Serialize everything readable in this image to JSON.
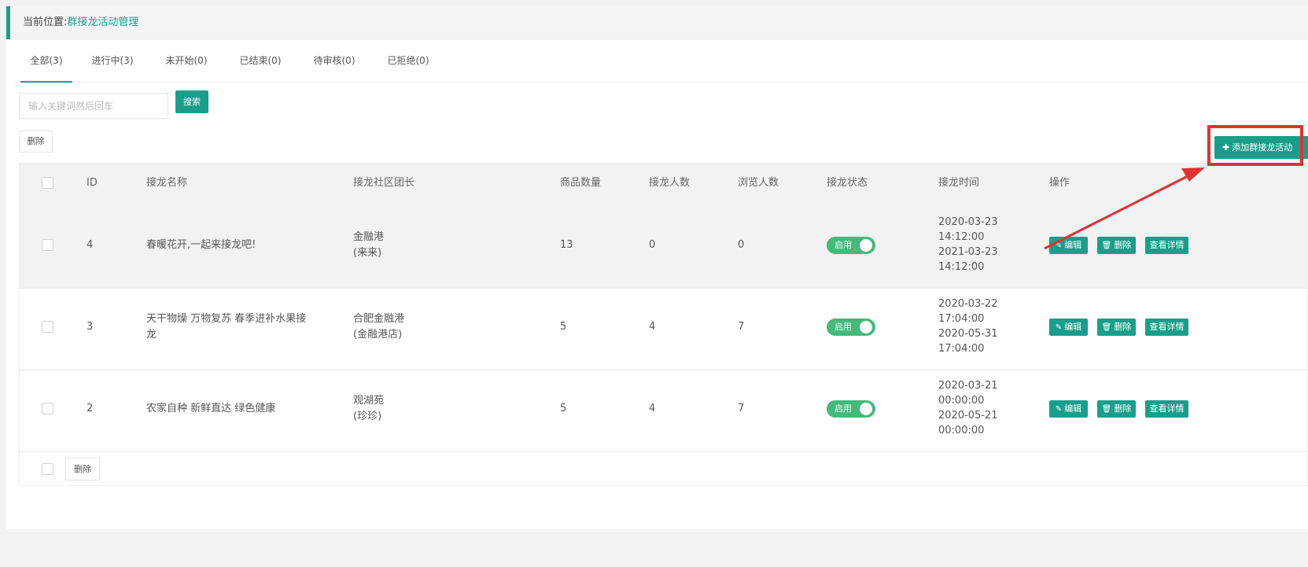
{
  "breadcrumb": {
    "prefix": "当前位置:",
    "current": "群接龙活动管理"
  },
  "tabs": [
    {
      "label": "全部(3)"
    },
    {
      "label": "进行中(3)"
    },
    {
      "label": "未开始(0)"
    },
    {
      "label": "已结束(0)"
    },
    {
      "label": "待审核(0)"
    },
    {
      "label": "已拒绝(0)"
    }
  ],
  "search": {
    "placeholder": "输入关键词然后回车",
    "button": "搜索"
  },
  "toolbar": {
    "delete": "删除",
    "add": "添加群接龙活动"
  },
  "table": {
    "headers": [
      "ID",
      "接龙名称",
      "接龙社区团长",
      "商品数量",
      "接龙人数",
      "浏览人数",
      "接龙状态",
      "接龙时间",
      "操作"
    ],
    "rows": [
      {
        "id": "4",
        "name": "春暖花开,一起来接龙吧!",
        "leader": "金融港",
        "leader_sub": "(来来)",
        "goods": "13",
        "join": "0",
        "views": "0",
        "status": "启用",
        "time_lines": [
          "2020-03-23",
          "14:12:00",
          "2021-03-23",
          "14:12:00"
        ]
      },
      {
        "id": "3",
        "name": "天干物燥 万物复苏 春季进补水果接龙",
        "leader": "合肥金融港",
        "leader_sub": "(金融港店)",
        "goods": "5",
        "join": "4",
        "views": "7",
        "status": "启用",
        "time_lines": [
          "2020-03-22",
          "17:04:00",
          "2020-05-31",
          "17:04:00"
        ]
      },
      {
        "id": "2",
        "name": "农家自种 新鲜直达 绿色健康",
        "leader": "观湖苑",
        "leader_sub": "(珍珍)",
        "goods": "5",
        "join": "4",
        "views": "7",
        "status": "启用",
        "time_lines": [
          "2020-03-21",
          "00:00:00",
          "2020-05-21",
          "00:00:00"
        ]
      }
    ],
    "actions": {
      "edit": "编辑",
      "delete": "删除",
      "detail": "查看详情"
    }
  },
  "footer": {
    "delete": "删除"
  },
  "colors": {
    "accent": "#1a9e8c",
    "switch_on": "#45b97c",
    "annotation": "#e53030"
  },
  "icons": {
    "edit": "pencil-icon",
    "delete": "trash-icon",
    "add": "plus-icon"
  }
}
